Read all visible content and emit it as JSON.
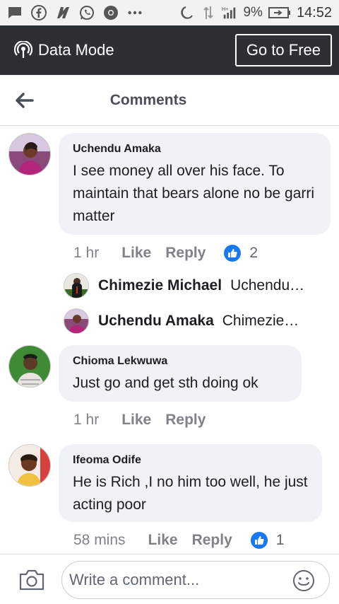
{
  "status_bar": {
    "battery": "9%",
    "time": "14:52"
  },
  "data_bar": {
    "label": "Data Mode",
    "cta": "Go to Free"
  },
  "header": {
    "title": "Comments"
  },
  "comments": [
    {
      "author": "Uchendu Amaka",
      "text": "I see money all over his face. To maintain that bears alone no be garri matter",
      "time": "1 hr",
      "like": "Like",
      "reply": "Reply",
      "like_count": "2"
    },
    {
      "author": "Chioma Lekwuwa",
      "text": "Just go and get sth doing ok",
      "time": "1 hr",
      "like": "Like",
      "reply": "Reply"
    },
    {
      "author": "Ifeoma Odife",
      "text": "He is Rich ,I no him too well, he just acting poor",
      "time": "58 mins",
      "like": "Like",
      "reply": "Reply",
      "like_count": "1"
    }
  ],
  "replies": [
    {
      "author": "Chimezie Michael",
      "snippet": "Uchendu…"
    },
    {
      "author": "Uchendu Amaka",
      "snippet": "Chimezie…"
    }
  ],
  "composer": {
    "placeholder": "Write a comment..."
  },
  "colors": {
    "facebook_blue": "#1877f2",
    "bubble_gray": "#f0f2f5",
    "data_bar_bg": "#2c2f33"
  }
}
